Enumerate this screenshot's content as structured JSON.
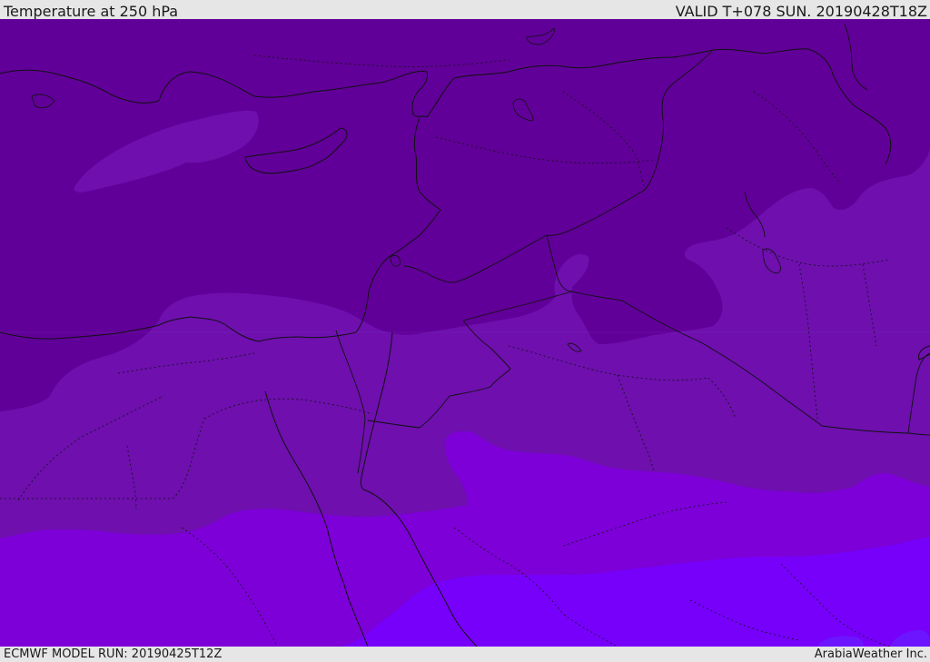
{
  "header": {
    "title": "Temperature at 250 hPa",
    "valid": "VALID T+078 SUN. 20190428T18Z"
  },
  "footer": {
    "model_run": "ECMWF MODEL RUN: 20190425T12Z",
    "credit": "ArabiaWeather Inc."
  },
  "colors": {
    "coldest": "#610098",
    "cold": "#6e0fae",
    "mid": "#7d00d8",
    "warm": "#7700fb",
    "warmest": "#6b16ff",
    "border": "#111111"
  }
}
